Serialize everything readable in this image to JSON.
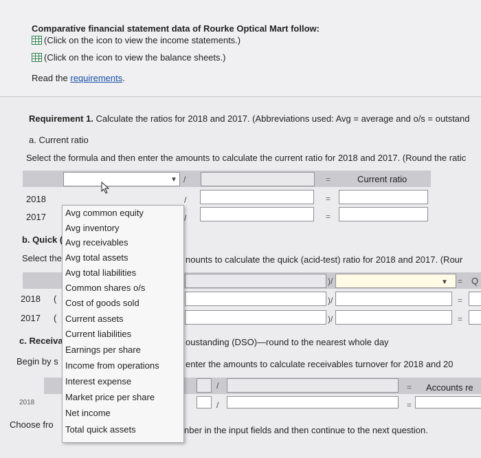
{
  "intro": {
    "heading": "Comparative financial statement data of Rourke Optical Mart follow:",
    "income_link": "(Click on the icon to view the income statements.)",
    "balance_link": "(Click on the icon to view the balance sheets.)",
    "read_prefix": "Read the ",
    "requirements_link": "requirements",
    "read_suffix": "."
  },
  "req1": {
    "label": "Requirement 1.",
    "text": " Calculate the ratios for 2018 and 2017. (Abbreviations used: Avg = average and o/s = outstand"
  },
  "current_ratio": {
    "title": "a. Current ratio",
    "instruction": "Select the formula and then enter the amounts to calculate the current ratio for 2018 and 2017. (Round the ratic",
    "result_header": "Current ratio",
    "slash": "/",
    "equals": "=",
    "rows": [
      "2018",
      "2017"
    ]
  },
  "quick": {
    "title": "b. Quick (",
    "instruction_start": "Select the",
    "instruction_end": "nounts to calculate the quick (acid-test) ratio for 2018 and 2017. (Rour",
    "row_2018": "2018",
    "row_2017": "2017",
    "paren": "(",
    "slash_paren": ")/",
    "equals": "=",
    "header_right_fragment": "Q"
  },
  "receivables": {
    "title": "c. Receiva",
    "title_end": "oustanding (DSO)—round to the nearest whole day",
    "begin_start": "Begin by s",
    "begin_end": "enter the amounts to calculate receivables turnover for 2018 and 20",
    "header_right": "Accounts re",
    "row_2018": "2018",
    "slash": "/",
    "equals": "="
  },
  "footer": {
    "choose_start": "Choose fro",
    "choose_end": "nber in the input fields and then continue to the next question."
  },
  "dropdown": {
    "options": [
      "Avg common equity",
      "Avg inventory",
      "Avg receivables",
      "Avg total assets",
      "Avg total liabilities",
      "Common shares o/s",
      "Cost of goods sold",
      "Current assets",
      "Current liabilities",
      "Earnings per share",
      "Income from operations",
      "Interest expense",
      "Market price per share",
      "Net income",
      "Total quick assets"
    ]
  },
  "colors": {
    "link": "#1a4fa8",
    "icon": "#2e7d4a",
    "header_bar": "#cbcbcf",
    "panel": "#ececee"
  },
  "icons": [
    "table-icon",
    "chevron-down-icon",
    "mouse-cursor-icon"
  ]
}
